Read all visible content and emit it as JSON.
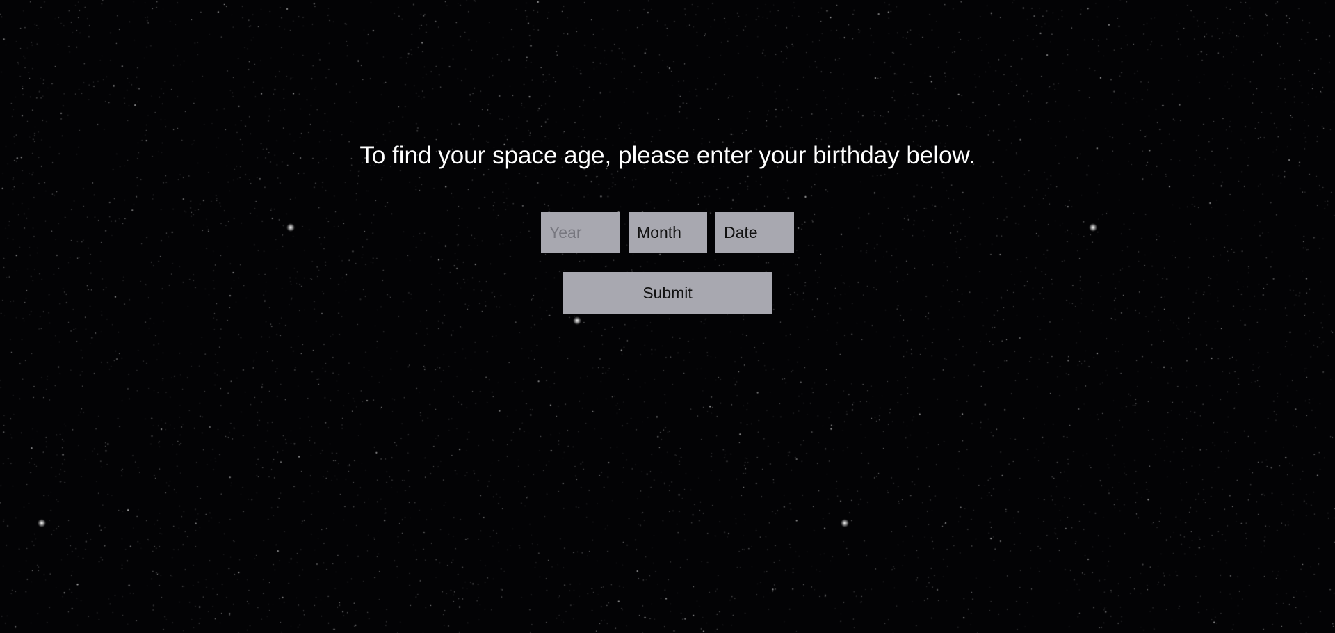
{
  "page": {
    "prompt": "To find your space age, please enter your birthday below."
  },
  "form": {
    "year": {
      "placeholder": "Year",
      "value": ""
    },
    "month": {
      "placeholder": "Month",
      "value": "Month"
    },
    "date": {
      "placeholder": "Date",
      "value": "Date"
    },
    "submit_label": "Submit"
  },
  "colors": {
    "background": "#030305",
    "text": "#ffffff",
    "control_fill": "#a8a8b0",
    "control_text": "#111111",
    "placeholder_text": "#77777f",
    "stars": "#ffffff"
  }
}
